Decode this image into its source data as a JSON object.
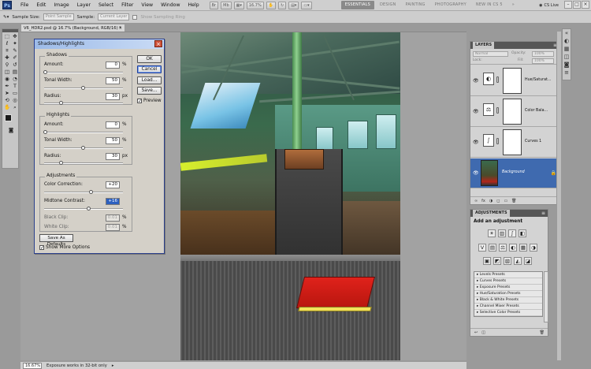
{
  "menubar": {
    "app_logo": "Ps",
    "items": [
      "File",
      "Edit",
      "Image",
      "Layer",
      "Select",
      "Filter",
      "View",
      "Window",
      "Help"
    ],
    "zoom_value": "16.7%",
    "workspace_tabs": [
      "ESSENTIALS",
      "DESIGN",
      "PAINTING",
      "PHOTOGRAPHY",
      "NEW IN CS 5"
    ],
    "active_workspace": "ESSENTIALS",
    "cs_live": "CS Live"
  },
  "options_bar": {
    "sample_size_label": "Sample Size:",
    "sample_size_value": "Point Sample",
    "sample_label": "Sample:",
    "sample_value": "Current Layer",
    "show_ring_label": "Show Sampling Ring"
  },
  "document": {
    "tab_title": "V6_HDR2.psd @ 16.7% (Background, RGB/16) *",
    "close_glyph": "×"
  },
  "dialog": {
    "title": "Shadows/Highlights",
    "close_glyph": "×",
    "shadows": {
      "label": "Shadows",
      "amount": {
        "label": "Amount:",
        "value": "0",
        "unit": "%"
      },
      "tonal_width": {
        "label": "Tonal Width:",
        "value": "50",
        "unit": "%"
      },
      "radius": {
        "label": "Radius:",
        "value": "30",
        "unit": "px"
      }
    },
    "highlights": {
      "label": "Highlights",
      "amount": {
        "label": "Amount:",
        "value": "0",
        "unit": "%"
      },
      "tonal_width": {
        "label": "Tonal Width:",
        "value": "50",
        "unit": "%"
      },
      "radius": {
        "label": "Radius:",
        "value": "30",
        "unit": "px"
      }
    },
    "adjustments": {
      "label": "Adjustments",
      "color_correction": {
        "label": "Color Correction:",
        "value": "+20"
      },
      "midtone_contrast": {
        "label": "Midtone Contrast:",
        "value": "+16"
      },
      "black_clip": {
        "label": "Black Clip:",
        "value": "0.01",
        "unit": "%"
      },
      "white_clip": {
        "label": "White Clip:",
        "value": "0.01",
        "unit": "%"
      }
    },
    "buttons": {
      "ok": "OK",
      "cancel": "Cancel",
      "load": "Load...",
      "save": "Save..."
    },
    "preview_label": "Preview",
    "save_defaults": "Save As Defaults",
    "show_more_label": "Show More Options"
  },
  "layers_panel": {
    "title": "LAYERS",
    "blend_mode": "Normal",
    "opacity_label": "Opacity:",
    "opacity_value": "100%",
    "lock_label": "Lock:",
    "fill_label": "Fill:",
    "fill_value": "100%",
    "layers": [
      {
        "name": "Hue/Saturat...",
        "icon": "hue-saturation-icon",
        "glyph": "◐"
      },
      {
        "name": "Color Bala...",
        "icon": "color-balance-icon",
        "glyph": "⚖"
      },
      {
        "name": "Curves 1",
        "icon": "curves-icon",
        "glyph": "∫"
      },
      {
        "name": "Background",
        "icon": "image-thumbnail",
        "glyph": ""
      }
    ],
    "footer_glyphs": [
      "∞",
      "fx",
      "◑",
      "◻",
      "▭",
      "🗑"
    ]
  },
  "adjustments_panel": {
    "title": "ADJUSTMENTS",
    "subtitle": "Add an adjustment",
    "icon_rows": [
      [
        "☀",
        "▥",
        "∫",
        "◧"
      ],
      [
        "V",
        "▤",
        "⚖",
        "◐",
        "▦",
        "◑"
      ],
      [
        "▣",
        "◩",
        "▧",
        "◭",
        "◪"
      ]
    ],
    "presets": [
      "Levels Presets",
      "Curves Presets",
      "Exposure Presets",
      "Hue/Saturation Presets",
      "Black & White Presets",
      "Channel Mixer Presets",
      "Selective Color Presets"
    ]
  },
  "status_bar": {
    "zoom": "16.67%",
    "message": "Exposure works in 32-bit only"
  }
}
